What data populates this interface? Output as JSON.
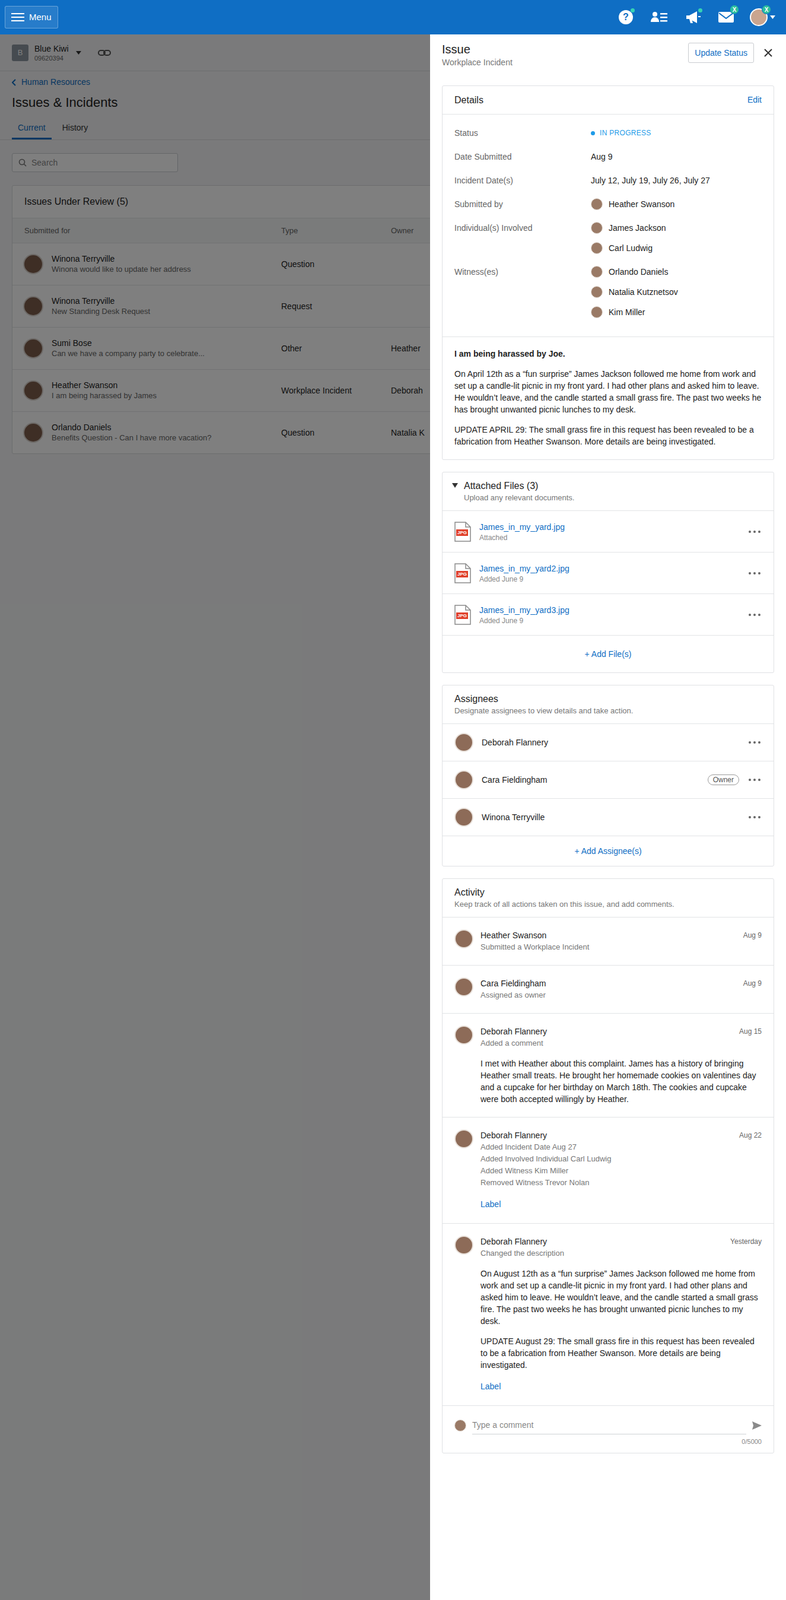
{
  "header": {
    "menu": "Menu",
    "help": {
      "glyph": "?",
      "dot": true
    },
    "directory": {
      "dot": false
    },
    "announcements": {
      "dot": true
    },
    "inbox": {
      "badge": "X"
    },
    "account": {
      "badge": "X"
    }
  },
  "company": {
    "initial": "B",
    "name": "Blue Kiwi",
    "number": "09620394"
  },
  "breadcrumb": "Human Resources",
  "page_title": "Issues & Incidents",
  "tabs": [
    {
      "label": "Current",
      "selected": true
    },
    {
      "label": "History",
      "selected": false
    }
  ],
  "search": {
    "placeholder": "Search"
  },
  "table": {
    "title": "Issues Under Review (5)",
    "columns": [
      "Submitted for",
      "Type",
      "Owner"
    ],
    "rows": [
      {
        "name": "Winona Terryville",
        "summary": "Winona would like to update her address",
        "type": "Question"
      },
      {
        "name": "Winona Terryville",
        "summary": "New Standing Desk Request",
        "type": "Request"
      },
      {
        "name": "Sumi Bose",
        "summary": "Can we have a company party to celebrate...",
        "type": "Other",
        "owner": "Heather"
      },
      {
        "name": "Heather Swanson",
        "summary": "I am being harassed by James",
        "type": "Workplace Incident",
        "owner": "Deborah"
      },
      {
        "name": "Orlando Daniels",
        "summary": "Benefits Question - Can I have more vacation?",
        "type": "Question",
        "owner": "Natalia K"
      }
    ]
  },
  "panel": {
    "title": "Issue",
    "subtitle": "Workplace Incident",
    "update_button": "Update Status",
    "details": {
      "title": "Details",
      "edit": "Edit",
      "fields": [
        {
          "label": "Status",
          "kind": "status",
          "value": "IN PROGRESS",
          "color": "#1e9be8"
        },
        {
          "label": "Date Submitted",
          "kind": "text",
          "value": "Aug 9"
        },
        {
          "label": "Incident Date(s)",
          "kind": "text",
          "value": "July 12, July 19, July 26, July 27"
        },
        {
          "label": "Submitted by",
          "kind": "people",
          "people": [
            "Heather Swanson"
          ]
        },
        {
          "label": "Individual(s) Involved",
          "kind": "people",
          "people": [
            "James Jackson",
            "Carl Ludwig"
          ]
        },
        {
          "label": "Witness(es)",
          "kind": "people",
          "people": [
            "Orlando Daniels",
            "Natalia Kutznetsov",
            "Kim Miller"
          ]
        }
      ],
      "description": {
        "title": "I am being harassed by Joe.",
        "paragraphs": [
          "On April 12th as a “fun surprise” James Jackson followed me home from work and set up a candle-lit picnic in my front yard. I had other plans and asked him to leave. He wouldn’t leave, and the candle started a small grass fire. The past two weeks he has brought unwanted picnic lunches to my desk.",
          "UPDATE APRIL 29: The small grass fire in this request has been revealed to be a fabrication from Heather Swanson. More details are being investigated."
        ]
      }
    },
    "files": {
      "title": "Attached Files (3)",
      "subtitle": "Upload any relevant documents.",
      "expanded": true,
      "items": [
        {
          "name": "James_in_my_yard.jpg",
          "meta": "Attached",
          "type": "JPG"
        },
        {
          "name": "James_in_my_yard2.jpg",
          "meta": "Added June 9",
          "type": "JPG"
        },
        {
          "name": "James_in_my_yard3.jpg",
          "meta": "Added June 9",
          "type": "JPG"
        }
      ],
      "add": "+ Add File(s)"
    },
    "assignees": {
      "title": "Assignees",
      "subtitle": "Designate assignees to view details and take action.",
      "owner_label": "Owner",
      "items": [
        {
          "name": "Deborah Flannery",
          "owner": false
        },
        {
          "name": "Cara Fieldingham",
          "owner": true
        },
        {
          "name": "Winona Terryville",
          "owner": false
        }
      ],
      "add": "+ Add Assignee(s)"
    },
    "activity": {
      "title": "Activity",
      "subtitle": "Keep track of all actions taken on this issue, and add comments.",
      "items": [
        {
          "name": "Heather Swanson",
          "lines": [
            "Submitted a Workplace Incident"
          ],
          "date": "Aug 9",
          "body": []
        },
        {
          "name": "Cara Fieldingham",
          "lines": [
            "Assigned as owner"
          ],
          "date": "Aug 9",
          "body": []
        },
        {
          "name": "Deborah Flannery",
          "lines": [
            "Added a comment"
          ],
          "date": "Aug 15",
          "body": [
            "I met with Heather about this complaint. James has a history of bringing Heather small treats. He brought her homemade cookies on valentines day and a cupcake for her birthday on March 18th. The cookies and cupcake were both accepted willingly by Heather."
          ]
        },
        {
          "name": "Deborah Flannery",
          "lines": [
            "Added Incident Date Aug 27",
            "Added Involved Individual Carl Ludwig",
            "Added Witness Kim Miller",
            "Removed Witness Trevor Nolan"
          ],
          "date": "Aug 22",
          "body": [],
          "link": "Label"
        },
        {
          "name": "Deborah Flannery",
          "lines": [
            "Changed the description"
          ],
          "date": "Yesterday",
          "body": [
            "On August 12th as a “fun surprise” James Jackson followed me home from work and set up a candle-lit picnic in my front yard. I had other plans and asked him to leave. He wouldn’t leave, and the candle started a small grass fire. The past two weeks he has brought unwanted picnic lunches to my desk.",
            "UPDATE August 29: The small grass fire in this request has been revealed to be a fabrication from Heather Swanson. More details are being investigated."
          ],
          "link": "Label"
        }
      ]
    },
    "comment": {
      "placeholder": "Type a comment",
      "counter": "0/5000"
    }
  }
}
